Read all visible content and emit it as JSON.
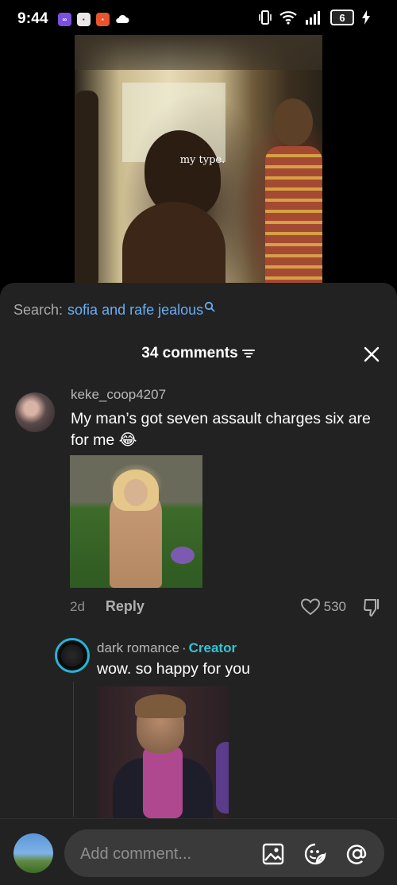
{
  "status_bar": {
    "time": "9:44",
    "battery": "6"
  },
  "video": {
    "caption": "my type."
  },
  "search": {
    "prefix": "Search:",
    "query": "sofia and rafe jealous"
  },
  "comments": {
    "header": "34 comments",
    "items": [
      {
        "username": "keke_coop4207",
        "text": "My man’s got seven assault charges six are for me 😂",
        "age": "2d",
        "reply_label": "Reply",
        "likes": "530"
      }
    ],
    "replies": [
      {
        "username": "dark romance",
        "separator": "·",
        "badge": "Creator",
        "text": "wow. so happy for you"
      }
    ]
  },
  "composer": {
    "placeholder": "Add comment..."
  },
  "colors": {
    "link": "#6aaef5",
    "creator": "#34c4d8",
    "sheet_bg": "#222222"
  }
}
